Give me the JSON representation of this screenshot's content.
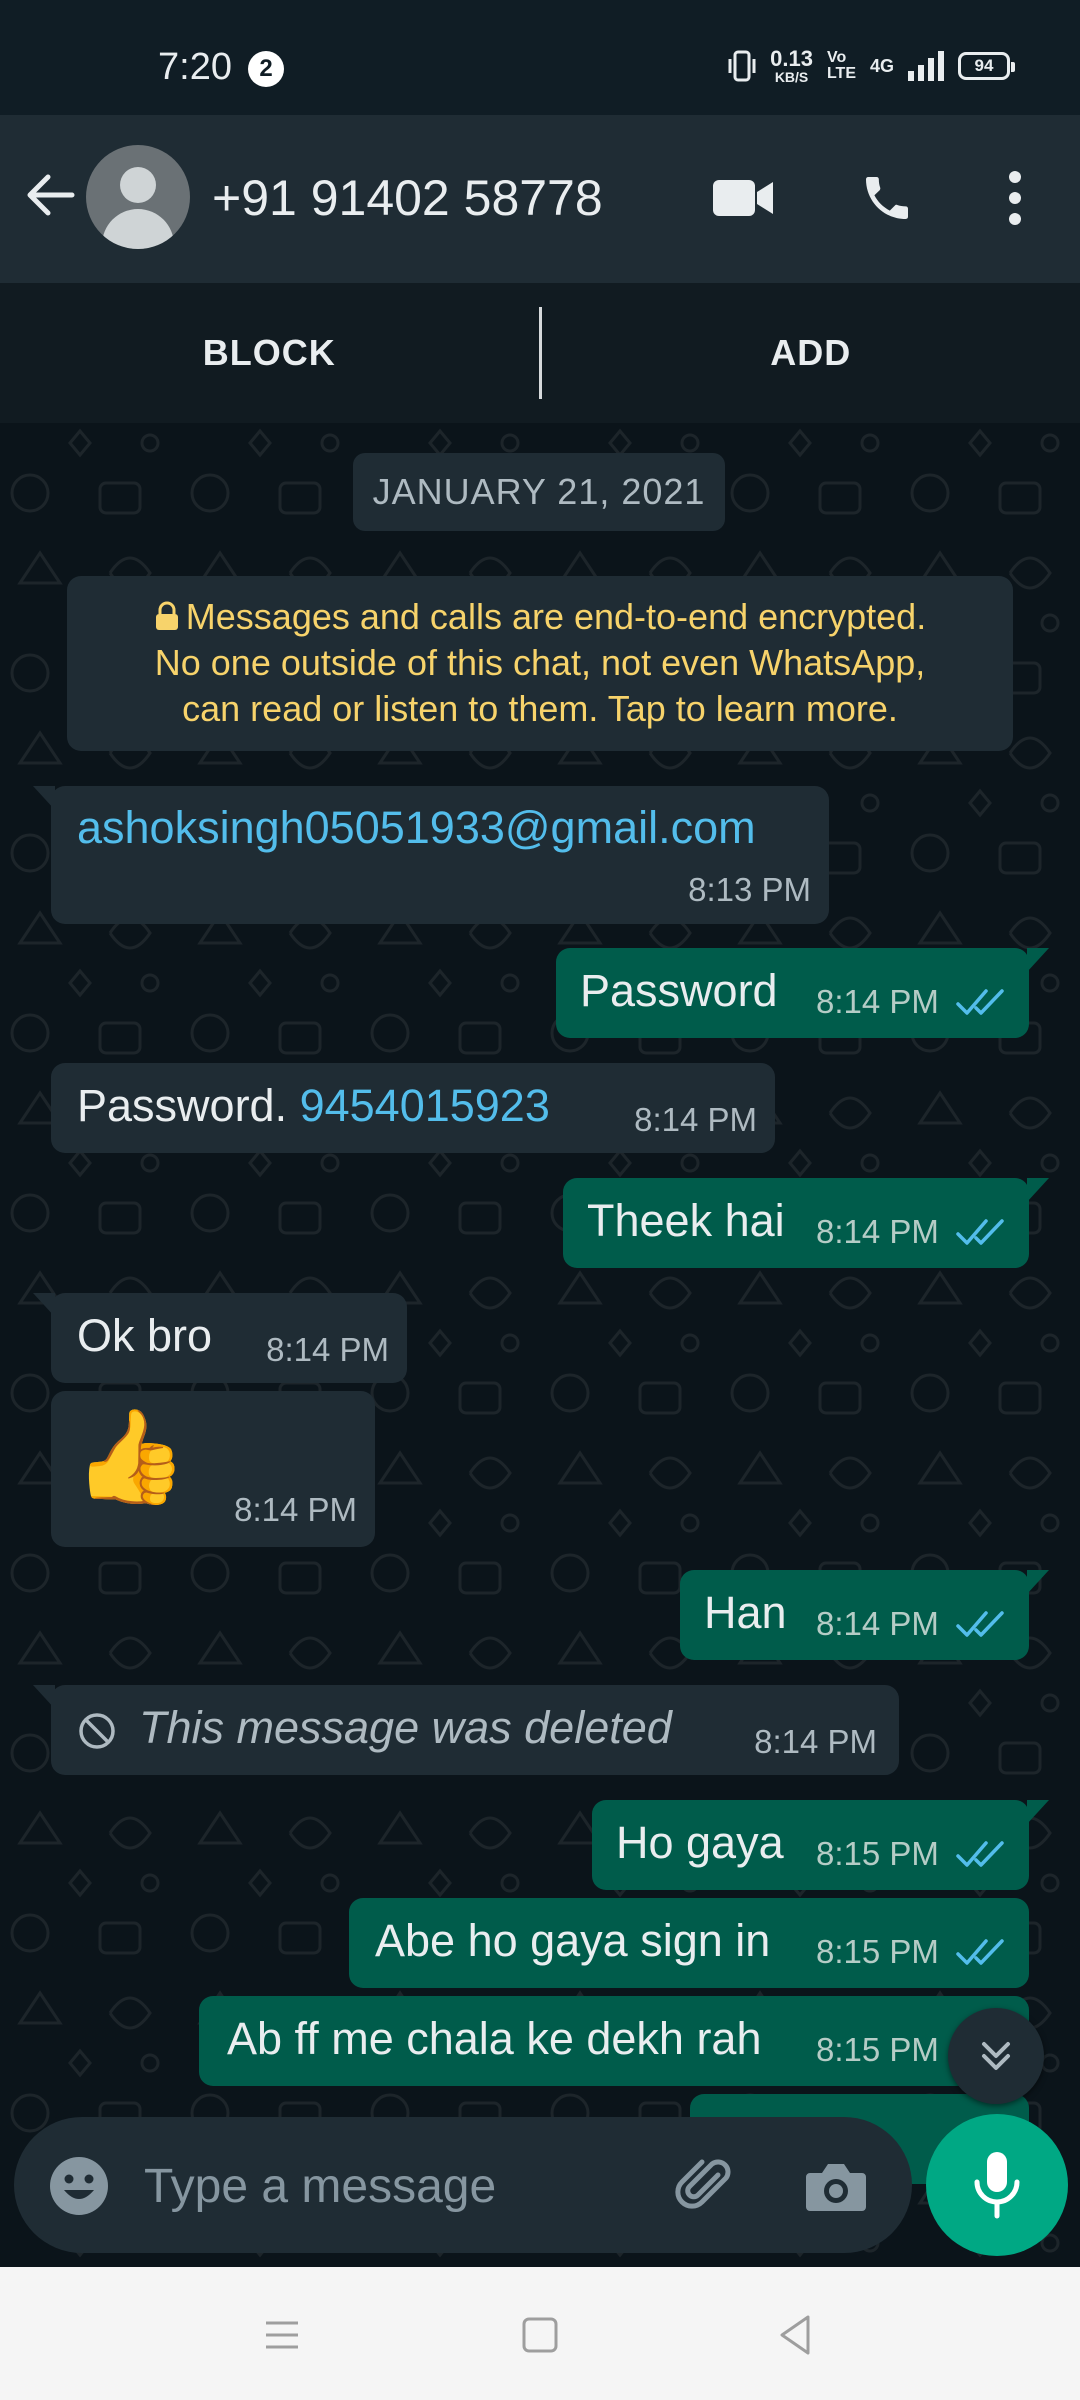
{
  "status_bar": {
    "time": "7:20",
    "notification_count": "2",
    "net_speed_value": "0.13",
    "net_speed_unit": "KB/S",
    "volte_top": "Vo",
    "volte_bottom": "LTE",
    "network": "4G",
    "battery": "94"
  },
  "header": {
    "contact": "+91 91402 58778",
    "icons": [
      "back-arrow-icon",
      "avatar",
      "video-call-icon",
      "phone-icon",
      "more-vert-icon"
    ]
  },
  "actions": {
    "block": "BLOCK",
    "add": "ADD"
  },
  "chat": {
    "date": "JANUARY 21, 2021",
    "encryption_notice": [
      "Messages and calls are end-to-end encrypted.",
      "No one outside of this chat, not even WhatsApp,",
      "can read or listen to them. Tap to learn more."
    ],
    "messages": [
      {
        "dir": "in",
        "text": "ashoksingh05051933@gmail.com",
        "time": "8:13 PM"
      },
      {
        "dir": "out",
        "text": "Password",
        "time": "8:14 PM",
        "status": "read"
      },
      {
        "dir": "in",
        "text_prefix": "Password. ",
        "text_link": "9454015923",
        "time": "8:14 PM"
      },
      {
        "dir": "out",
        "text": "Theek hai",
        "time": "8:14 PM",
        "status": "read"
      },
      {
        "dir": "in",
        "text": "Ok bro",
        "time": "8:14 PM"
      },
      {
        "dir": "in",
        "emoji": "👍",
        "time": "8:14 PM"
      },
      {
        "dir": "out",
        "text": "Han",
        "time": "8:14 PM",
        "status": "read"
      },
      {
        "dir": "in",
        "text": "This message was deleted",
        "time": "8:14 PM",
        "deleted": true
      },
      {
        "dir": "out",
        "text": "Ho gaya",
        "time": "8:15 PM",
        "status": "read"
      },
      {
        "dir": "out",
        "text": "Abe ho gaya sign in",
        "time": "8:15 PM",
        "status": "read"
      },
      {
        "dir": "out",
        "text": "Ab ff me chala ke dekh rah",
        "time": "8:15 PM",
        "status": "read"
      }
    ]
  },
  "input": {
    "placeholder": "Type a message"
  },
  "colors": {
    "outgoing_bubble": "#005c4b",
    "incoming_bubble": "#1f2c34",
    "accent": "#00a884",
    "read_ticks": "#53bdeb",
    "encryption_text": "#f7d36b"
  }
}
